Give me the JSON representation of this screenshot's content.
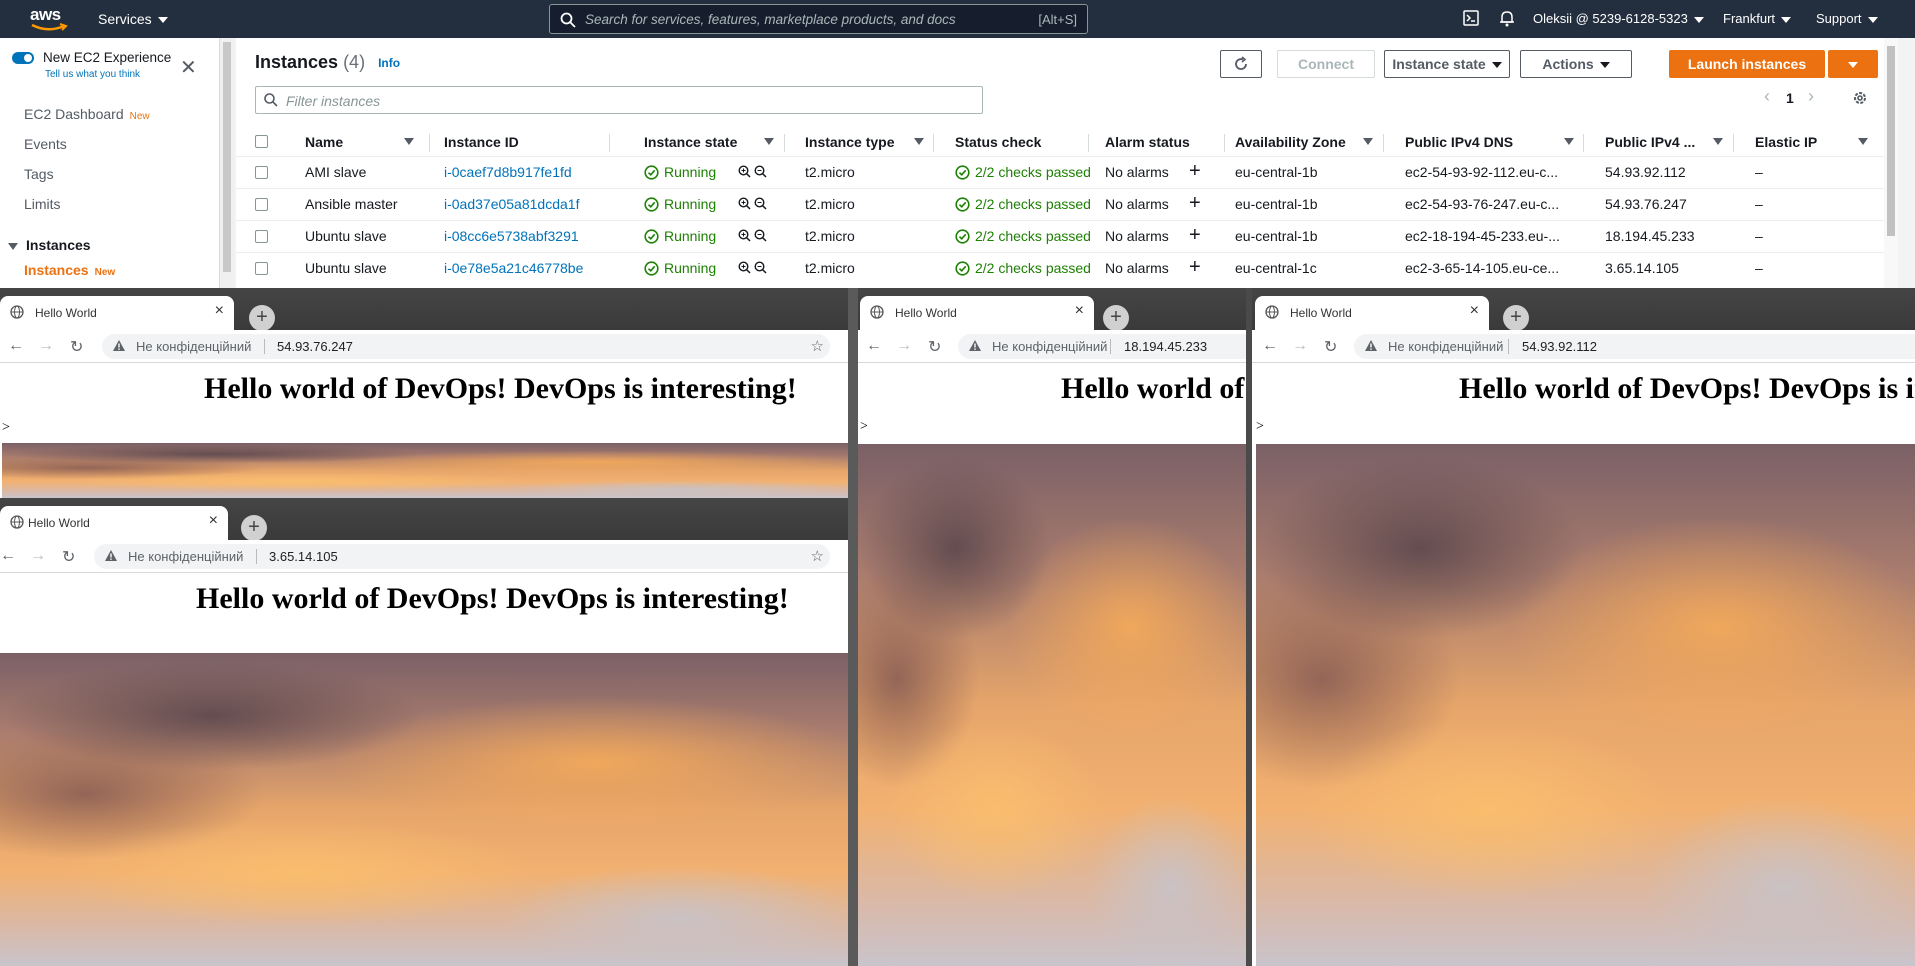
{
  "aws": {
    "logo": "aws",
    "services": "Services",
    "search_placeholder": "Search for services, features, marketplace products, and docs",
    "search_shortcut": "[Alt+S]",
    "account": "Oleksii @ 5239-6128-5323",
    "region": "Frankfurt",
    "support": "Support"
  },
  "sidebar": {
    "new_experience": "New EC2 Experience",
    "tell_us": "Tell us what you think",
    "items": [
      {
        "label": "EC2 Dashboard",
        "badge": "New"
      },
      {
        "label": "Events",
        "badge": ""
      },
      {
        "label": "Tags",
        "badge": ""
      },
      {
        "label": "Limits",
        "badge": ""
      }
    ],
    "section": "Instances",
    "active_item": "Instances",
    "active_badge": "New"
  },
  "instances": {
    "title": "Instances",
    "count": "(4)",
    "info": "Info",
    "connect": "Connect",
    "instance_state": "Instance state",
    "actions": "Actions",
    "launch": "Launch instances",
    "filter_placeholder": "Filter instances",
    "page": "1",
    "columns": [
      "Name",
      "Instance ID",
      "Instance state",
      "Instance type",
      "Status check",
      "Alarm status",
      "Availability Zone",
      "Public IPv4 DNS",
      "Public IPv4 ...",
      "Elastic IP"
    ],
    "rows": [
      {
        "name": "AMI slave",
        "id": "i-0caef7d8b917fe1fd",
        "state": "Running",
        "type": "t2.micro",
        "status": "2/2 checks passed",
        "alarm": "No alarms",
        "az": "eu-central-1b",
        "dns": "ec2-54-93-92-112.eu-c...",
        "ip": "54.93.92.112",
        "eip": "–"
      },
      {
        "name": "Ansible master",
        "id": "i-0ad37e05a81dcda1f",
        "state": "Running",
        "type": "t2.micro",
        "status": "2/2 checks passed",
        "alarm": "No alarms",
        "az": "eu-central-1b",
        "dns": "ec2-54-93-76-247.eu-c...",
        "ip": "54.93.76.247",
        "eip": "–"
      },
      {
        "name": "Ubuntu slave",
        "id": "i-08cc6e5738abf3291",
        "state": "Running",
        "type": "t2.micro",
        "status": "2/2 checks passed",
        "alarm": "No alarms",
        "az": "eu-central-1b",
        "dns": "ec2-18-194-45-233.eu-...",
        "ip": "18.194.45.233",
        "eip": "–"
      },
      {
        "name": "Ubuntu slave",
        "id": "i-0e78e5a21c46778be",
        "state": "Running",
        "type": "t2.micro",
        "status": "2/2 checks passed",
        "alarm": "No alarms",
        "az": "eu-central-1c",
        "dns": "ec2-3-65-14-105.eu-ce...",
        "ip": "3.65.14.105",
        "eip": "–"
      }
    ]
  },
  "browsers": [
    {
      "tab": "Hello World",
      "security": "Не конфіденційний",
      "url": "54.93.76.247",
      "heading": "Hello world of DevOps! DevOps is interesting!",
      "marker": ">"
    },
    {
      "tab": "Hello World",
      "security": "Не конфіденційний",
      "url": "3.65.14.105",
      "heading": "Hello world of DevOps! DevOps is interesting!",
      "marker": ""
    },
    {
      "tab": "Hello World",
      "security": "Не конфіденційний",
      "url": "18.194.45.233",
      "heading": "Hello world of DevOps! DevOps is interesting!",
      "marker": ">"
    },
    {
      "tab": "Hello World",
      "security": "Не конфіденційний",
      "url": "54.93.92.112",
      "heading": "Hello world of DevOps! DevOps is interesting!",
      "marker": ">"
    }
  ],
  "colors": {
    "aws_nav": "#232f3e",
    "accent": "#ec7211",
    "link": "#0073bb",
    "success": "#1d8102"
  }
}
